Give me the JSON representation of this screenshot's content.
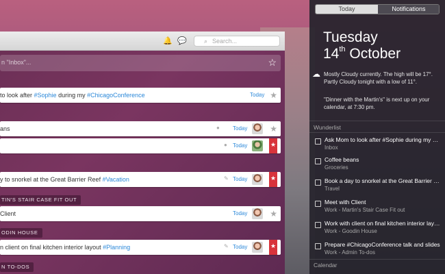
{
  "window": {
    "search_placeholder": "Search...",
    "icons": {
      "bell": "bell-icon",
      "comments": "speech-bubble-icon",
      "search": "magnifier-icon"
    }
  },
  "add_todo": {
    "placeholder": "n \"Inbox\"..."
  },
  "sections": [
    {
      "label": "TIN'S STAIR CASE FIT OUT"
    },
    {
      "label": "ODIN HOUSE"
    },
    {
      "label": "N TO-DOS"
    }
  ],
  "tasks": [
    {
      "prefix": "to look after ",
      "tag": "#Sophie",
      "middle": " during my ",
      "tag2": "#ChicagoConference",
      "due": "Today"
    },
    {
      "prefix": "ans",
      "due": "Today"
    },
    {
      "prefix": "",
      "due": "Today"
    },
    {
      "prefix": "y to snorkel at the Great Barrier Reef ",
      "tag": "#Vacation",
      "due": "Today"
    },
    {
      "prefix": "Client",
      "due": "Today"
    },
    {
      "prefix": "n client on final kitchen interior layout ",
      "tag": "#Planning",
      "due": "Today"
    }
  ],
  "notification_center": {
    "tabs": [
      "Today",
      "Notifications"
    ],
    "day": "Tuesday",
    "date_num": "14",
    "date_suffix": "th",
    "month": "October",
    "weather": "Mostly Cloudy currently. The high will be 17°. Partly Cloudy tonight with a low of 11°.",
    "calendar_note": "\"Dinner with the Martin's\" is next up on your calendar, at 7:30 pm.",
    "wunderlist_header": "Wunderlist",
    "calendar_header": "Calendar",
    "items": [
      {
        "title": "Ask Mom to look after #Sophie during my ChicagoConference",
        "list": "Inbox"
      },
      {
        "title": "Coffee beans",
        "list": "Groceries"
      },
      {
        "title": "Book a day to snorkel at the Great Barrier Reef",
        "list": "Travel"
      },
      {
        "title": "Meet with Client",
        "list": "Work - Martin's Stair Case Fit out"
      },
      {
        "title": "Work with client on final kitchen interior layout",
        "list": "Work - Goodin House"
      },
      {
        "title": "Prepare #ChicagoConference talk and slides",
        "list": "Work - Admin To-dos"
      }
    ]
  }
}
